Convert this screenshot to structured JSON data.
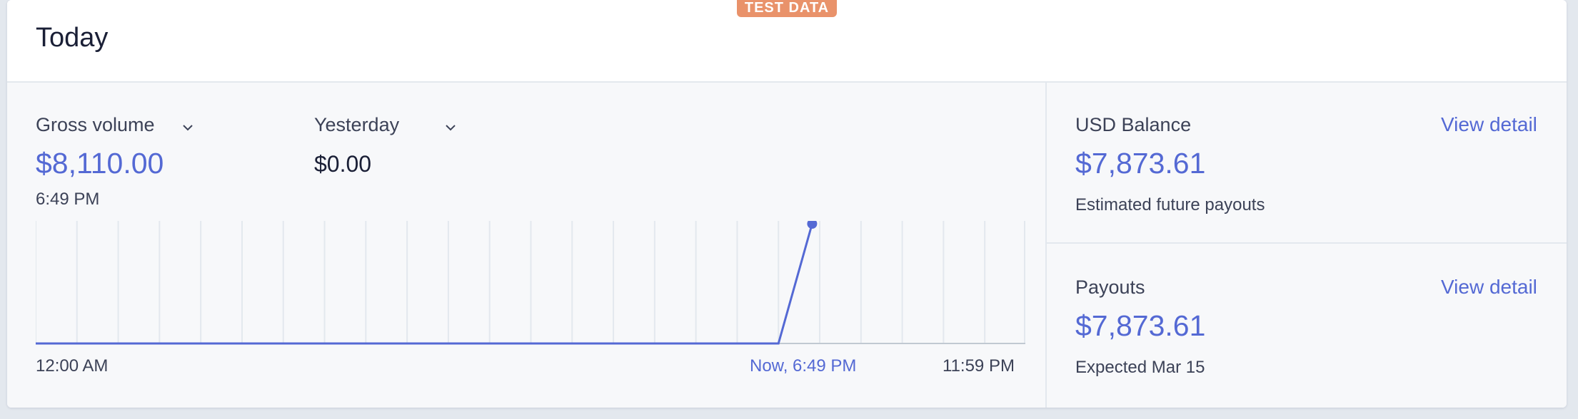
{
  "badge": "TEST DATA",
  "title": "Today",
  "gross": {
    "label": "Gross volume",
    "value": "$8,110.00",
    "time": "6:49 PM"
  },
  "compare": {
    "label": "Yesterday",
    "value": "$0.00"
  },
  "chart_axis": {
    "start": "12:00 AM",
    "now": "Now, 6:49 PM",
    "end": "11:59 PM"
  },
  "balance": {
    "label": "USD Balance",
    "link": "View detail",
    "value": "$7,873.61",
    "note": "Estimated future payouts"
  },
  "payouts": {
    "label": "Payouts",
    "link": "View detail",
    "value": "$7,873.61",
    "note": "Expected Mar 15"
  },
  "colors": {
    "accent": "#5469d4",
    "badge": "#e9926a"
  },
  "chart_data": {
    "type": "line",
    "x": [
      "12:00 AM",
      "6:00 PM",
      "6:49 PM"
    ],
    "values": [
      0,
      0,
      8110
    ],
    "ylim": [
      0,
      8110
    ],
    "grid": true
  }
}
